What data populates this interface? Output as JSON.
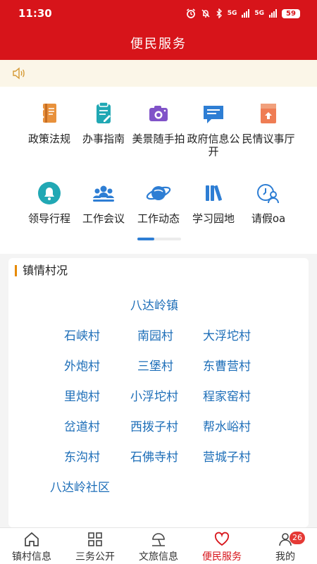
{
  "status_bar": {
    "time": "11:30",
    "network_a": "5G",
    "network_b": "5G",
    "battery": "59"
  },
  "header": {
    "title": "便民服务"
  },
  "services": [
    {
      "label": "政策法规",
      "icon": "policy-book-icon"
    },
    {
      "label": "办事指南",
      "icon": "guide-clipboard-icon"
    },
    {
      "label": "美景随手拍",
      "icon": "camera-icon"
    },
    {
      "label": "政府信息公开",
      "icon": "info-chat-icon"
    },
    {
      "label": "民情议事厅",
      "icon": "discussion-book-icon"
    },
    {
      "label": "领导行程",
      "icon": "bell-icon"
    },
    {
      "label": "工作会议",
      "icon": "meeting-people-icon"
    },
    {
      "label": "工作动态",
      "icon": "planet-icon"
    },
    {
      "label": "学习园地",
      "icon": "books-icon"
    },
    {
      "label": "请假oa",
      "icon": "clock-person-icon"
    }
  ],
  "villages_section": {
    "title": "镇情村况",
    "town": "八达岭镇",
    "villages": [
      "石峡村",
      "南园村",
      "大浮坨村",
      "外炮村",
      "三堡村",
      "东曹营村",
      "里炮村",
      "小浮坨村",
      "程家窑村",
      "岔道村",
      "西拨子村",
      "帮水峪村",
      "东沟村",
      "石佛寺村",
      "营城子村"
    ],
    "community": "八达岭社区"
  },
  "tabs": [
    {
      "label": "镇村信息",
      "icon": "home-icon"
    },
    {
      "label": "三务公开",
      "icon": "grid-icon"
    },
    {
      "label": "文旅信息",
      "icon": "beach-umbrella-icon"
    },
    {
      "label": "便民服务",
      "icon": "heart-icon"
    },
    {
      "label": "我的",
      "icon": "person-icon"
    }
  ],
  "tab_badge": "26",
  "colors": {
    "brand_red": "#d7141a",
    "link_blue": "#1d6eb8",
    "icon_teal": "#21a8b4",
    "icon_blue": "#2e7ed4",
    "icon_orange": "#e8913c",
    "icon_purple": "#8053c8"
  }
}
